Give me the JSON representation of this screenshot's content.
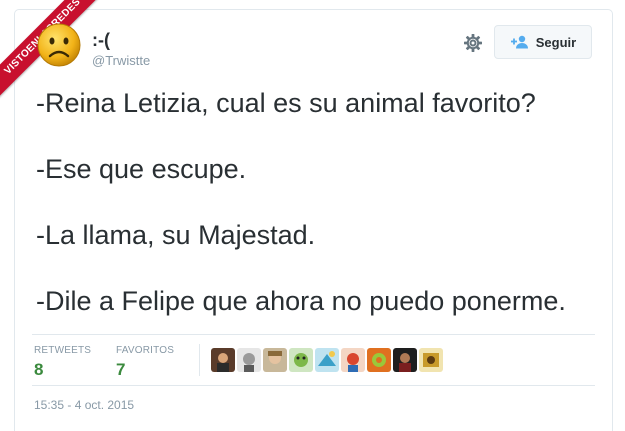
{
  "watermark": {
    "text": "VISTOENLASREDES"
  },
  "author": {
    "display_name": ":-(",
    "handle": "@Trwistte",
    "avatar_icon": "sad-face-emoji-icon"
  },
  "actions": {
    "settings_icon": "gear-icon",
    "follow_label": "Seguir",
    "follow_icon": "add-user-icon"
  },
  "tweet": {
    "lines": [
      "-Reina Letizia, cual es su animal favorito?",
      "-Ese que escupe.",
      "-La llama, su Majestad.",
      "-Dile a Felipe que ahora no puedo ponerme."
    ]
  },
  "stats": {
    "retweets_label": "RETWEETS",
    "retweets_count": "8",
    "favorites_label": "FAVORITOS",
    "favorites_count": "7"
  },
  "favoriters_count_shown": 9,
  "timestamp": "15:35 - 4 oct. 2015",
  "colors": {
    "ribbon": "#c8102e",
    "count": "#3b8a3e",
    "muted": "#8899a6",
    "text": "#292f33"
  }
}
